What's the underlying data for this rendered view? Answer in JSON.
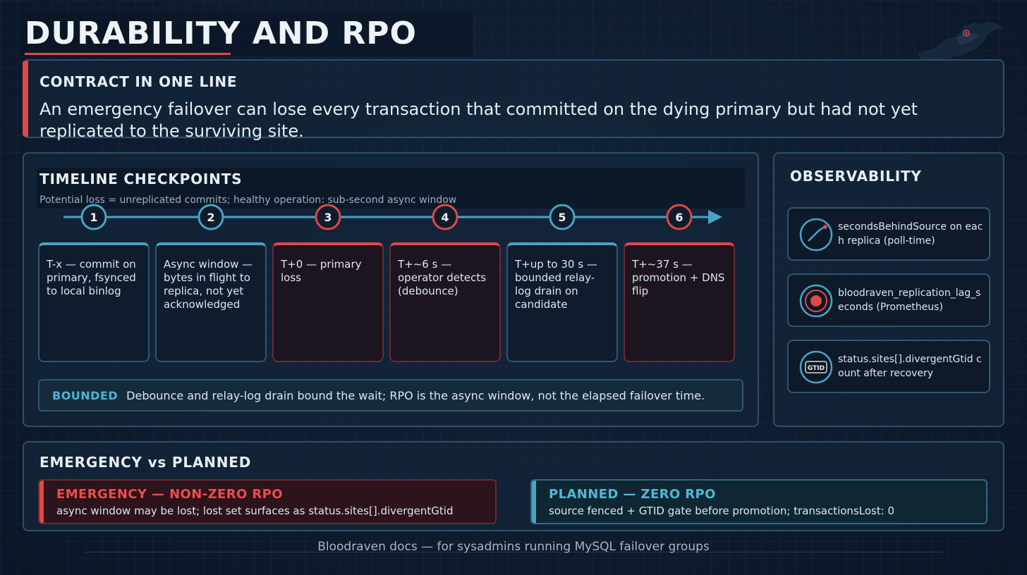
{
  "title": "DURABILITY AND RPO",
  "colors": {
    "danger": "#e04848",
    "accent": "#4aa3c4",
    "background": "#0d1a2b"
  },
  "contract": {
    "heading": "CONTRACT IN ONE LINE",
    "text": "An emergency failover can lose every transaction that committed on the dying primary but had not yet replicated to the surviving site."
  },
  "timeline": {
    "heading": "TIMELINE CHECKPOINTS",
    "subtitle": "Potential loss = unreplicated commits; healthy operation: sub-second async window",
    "steps": [
      {
        "num": "1",
        "text": "T-x — commit on primary, fsynced to local binlog",
        "severity": "normal"
      },
      {
        "num": "2",
        "text": "Async window — bytes in flight to replica, not yet acknowledged",
        "severity": "normal"
      },
      {
        "num": "3",
        "text": "T+0 — primary loss",
        "severity": "danger"
      },
      {
        "num": "4",
        "text": "T+~6 s — operator detects (debounce)",
        "severity": "danger"
      },
      {
        "num": "5",
        "text": "T+up to 30 s — bounded relay-log drain on candidate",
        "severity": "normal"
      },
      {
        "num": "6",
        "text": "T+~37 s — promotion + DNS flip",
        "severity": "danger"
      }
    ],
    "bounded_tag": "BOUNDED",
    "bounded_text": "Debounce and relay-log drain bound the wait; RPO is the async window, not the elapsed failover time."
  },
  "observability": {
    "heading": "OBSERVABILITY",
    "items": [
      {
        "icon": "gauge-icon",
        "text": "secondsBehindSource on each replica (poll-time)"
      },
      {
        "icon": "target-icon",
        "text": "bloodraven_replication_lag_seconds (Prometheus)"
      },
      {
        "icon": "gtid-icon",
        "label": "GTID",
        "text": "status.sites[].divergentGtid count after recovery"
      }
    ]
  },
  "emergency_vs_planned": {
    "heading": "EMERGENCY vs PLANNED",
    "emergency": {
      "title": "EMERGENCY — NON-ZERO RPO",
      "text": "async window may be lost; lost set surfaces as status.sites[].divergentGtid"
    },
    "planned": {
      "title": "PLANNED — ZERO RPO",
      "text": "source fenced + GTID gate before promotion; transactionsLost: 0"
    }
  },
  "footer": "Bloodraven docs — for sysadmins running MySQL failover groups"
}
